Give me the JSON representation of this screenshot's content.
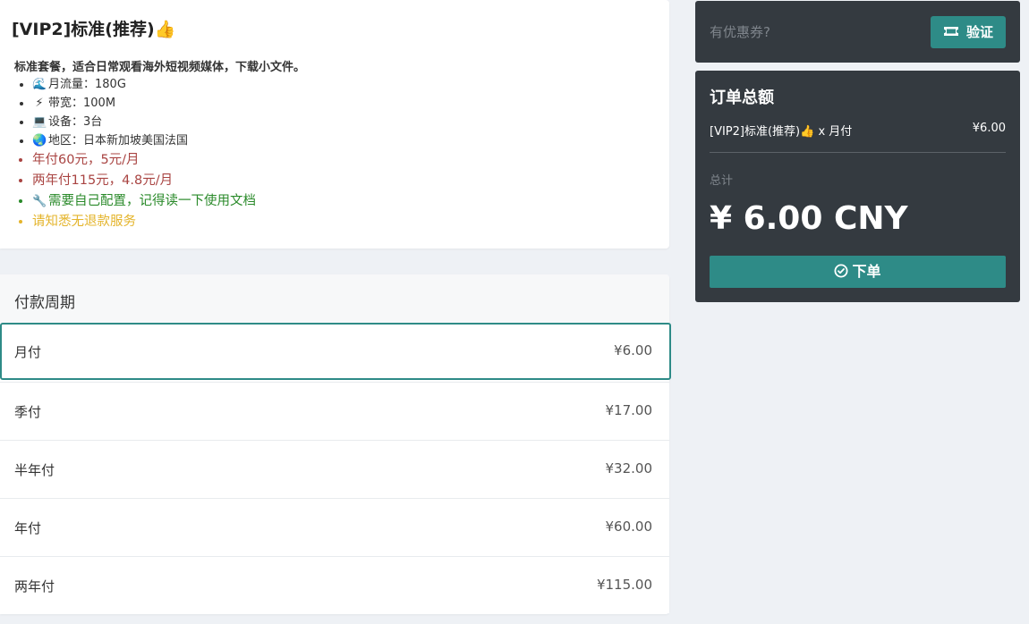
{
  "plan": {
    "title": "[VIP2]标准(推荐)",
    "title_icon": "thumbs-up-icon",
    "description": "标准套餐，适合日常观看海外短视频媒体，下载小文件。",
    "features": [
      {
        "icon": "wave-icon",
        "glyph": "🌊",
        "text": "月流量：180G"
      },
      {
        "icon": "lightning-icon",
        "glyph": "⚡",
        "text": "带宽：100M"
      },
      {
        "icon": "laptop-icon",
        "glyph": "💻",
        "text": "设备：3台"
      },
      {
        "icon": "globe-icon",
        "glyph": "🌏",
        "text": "地区：日本新加坡美国法国"
      }
    ],
    "price_notes": [
      "年付60元，5元/月",
      "两年付115元，4.8元/月"
    ],
    "config_note": {
      "icon": "wrench-icon",
      "glyph": "🔧",
      "text": "需要自己配置，记得读一下使用文档"
    },
    "refund_note": "请知悉无退款服务",
    "colors": {
      "price_note": "#a94442",
      "config_note": "#2a8a2a",
      "refund_note": "#e4b42b"
    }
  },
  "billing": {
    "header": "付款周期",
    "selected_index": 0,
    "cycles": [
      {
        "label": "月付",
        "price": "¥6.00"
      },
      {
        "label": "季付",
        "price": "¥17.00"
      },
      {
        "label": "半年付",
        "price": "¥32.00"
      },
      {
        "label": "年付",
        "price": "¥60.00"
      },
      {
        "label": "两年付",
        "price": "¥115.00"
      }
    ]
  },
  "coupon": {
    "placeholder": "有优惠券?",
    "verify_label": "验证",
    "verify_icon": "ticket-icon"
  },
  "summary": {
    "title": "订单总额",
    "line_label": "[VIP2]标准(推荐)👍 x 月付",
    "line_price": "¥6.00",
    "total_label": "总计",
    "total_amount": "¥ 6.00 CNY",
    "order_label": "下单",
    "order_icon": "check-circle-icon"
  },
  "theme": {
    "accent": "#2e8b87",
    "dark_panel": "#343a40",
    "background": "#eef1f5"
  }
}
